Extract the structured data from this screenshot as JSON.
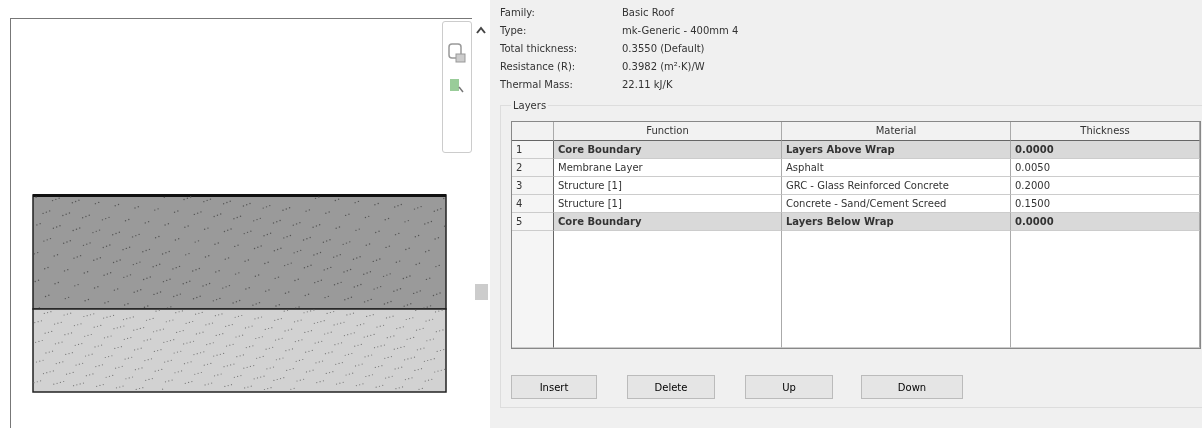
{
  "properties": [
    {
      "label": "Family:",
      "value": "Basic Roof"
    },
    {
      "label": "Type:",
      "value": "mk-Generic - 400mm 4"
    },
    {
      "label": "Total thickness:",
      "value": "0.3550 (Default)"
    },
    {
      "label": "Resistance (R):",
      "value": "0.3982 (m²·K)/W"
    },
    {
      "label": "Thermal Mass:",
      "value": "22.11 kJ/K"
    }
  ],
  "layers": {
    "title": "Layers",
    "columns": [
      "Function",
      "Material",
      "Thickness"
    ],
    "rows": [
      {
        "number": "1",
        "kind": "boundary",
        "function": "Core Boundary",
        "material": "Layers Above Wrap",
        "thickness": "0.0000"
      },
      {
        "number": "2",
        "kind": "layer",
        "function": "Membrane Layer",
        "material": "Asphalt",
        "thickness": "0.0050"
      },
      {
        "number": "3",
        "kind": "layer",
        "function": "Structure [1]",
        "material": "GRC -  Glass Reinforced Concrete",
        "thickness": "0.2000"
      },
      {
        "number": "4",
        "kind": "layer",
        "function": "Structure [1]",
        "material": "Concrete - Sand/Cement Screed",
        "thickness": "0.1500"
      },
      {
        "number": "5",
        "kind": "boundary",
        "function": "Core Boundary",
        "material": "Layers Below Wrap",
        "thickness": "0.0000"
      }
    ]
  },
  "buttons": [
    "Insert",
    "Delete",
    "Up",
    "Down"
  ]
}
